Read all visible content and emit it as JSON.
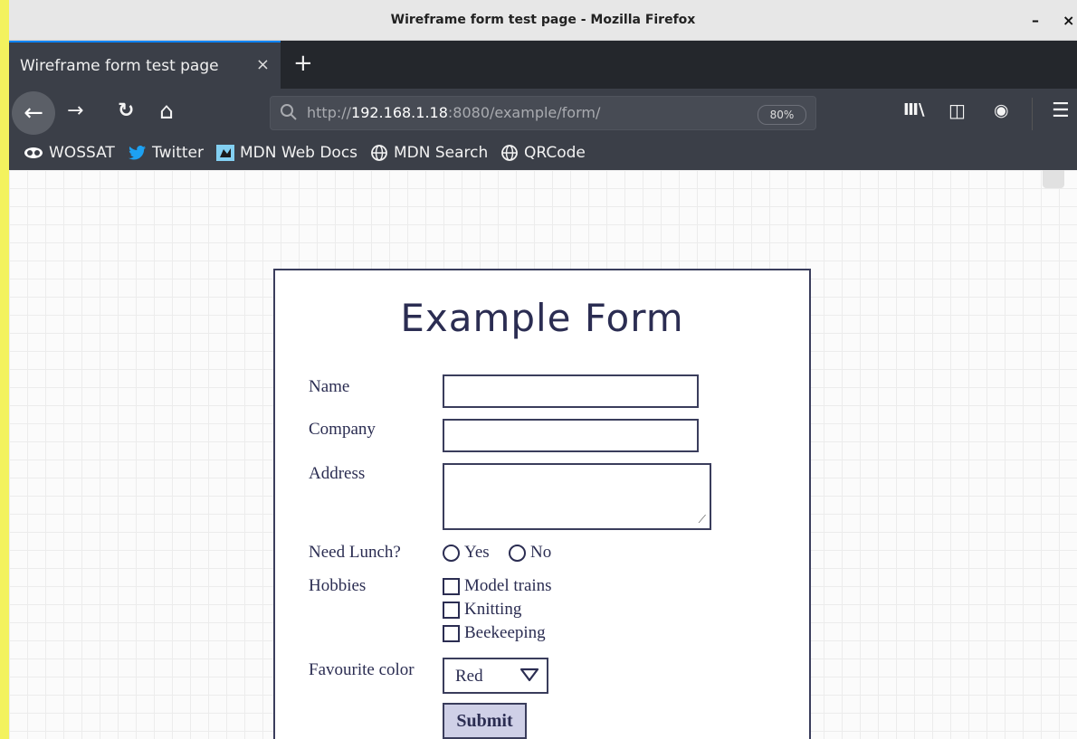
{
  "window": {
    "title": "Wireframe form test page - Mozilla Firefox",
    "minimize": "–",
    "close": "×"
  },
  "tab": {
    "label": "Wireframe form test page",
    "close": "×",
    "new_tab": "+"
  },
  "nav": {
    "back": "←",
    "forward": "→",
    "reload": "↻",
    "home": "⌂",
    "url_prefix": "http://",
    "url_host": "192.168.1.18",
    "url_suffix": ":8080/example/form/",
    "zoom": "80%",
    "library": "Ⅲ\\",
    "sidebar": "◫",
    "account": "◉",
    "menu": "☰"
  },
  "bookmarks": [
    {
      "label": "WOSSAT",
      "icon": "wossat-icon"
    },
    {
      "label": "Twitter",
      "icon": "twitter-icon"
    },
    {
      "label": "MDN Web Docs",
      "icon": "mdn-icon"
    },
    {
      "label": "MDN Search",
      "icon": "globe-icon"
    },
    {
      "label": "QRCode",
      "icon": "globe-icon"
    }
  ],
  "form": {
    "title": "Example Form",
    "name_label": "Name",
    "name_value": "",
    "company_label": "Company",
    "company_value": "",
    "address_label": "Address",
    "address_value": "",
    "lunch_label": "Need Lunch?",
    "lunch_options": [
      "Yes",
      "No"
    ],
    "hobbies_label": "Hobbies",
    "hobbies": [
      "Model trains",
      "Knitting",
      "Beekeeping"
    ],
    "color_label": "Favourite color",
    "color_selected": "Red",
    "submit_label": "Submit"
  },
  "colors": {
    "ink": "#2b2d52",
    "submit_bg": "#cfd0e7",
    "accent": "#0a84ff"
  }
}
